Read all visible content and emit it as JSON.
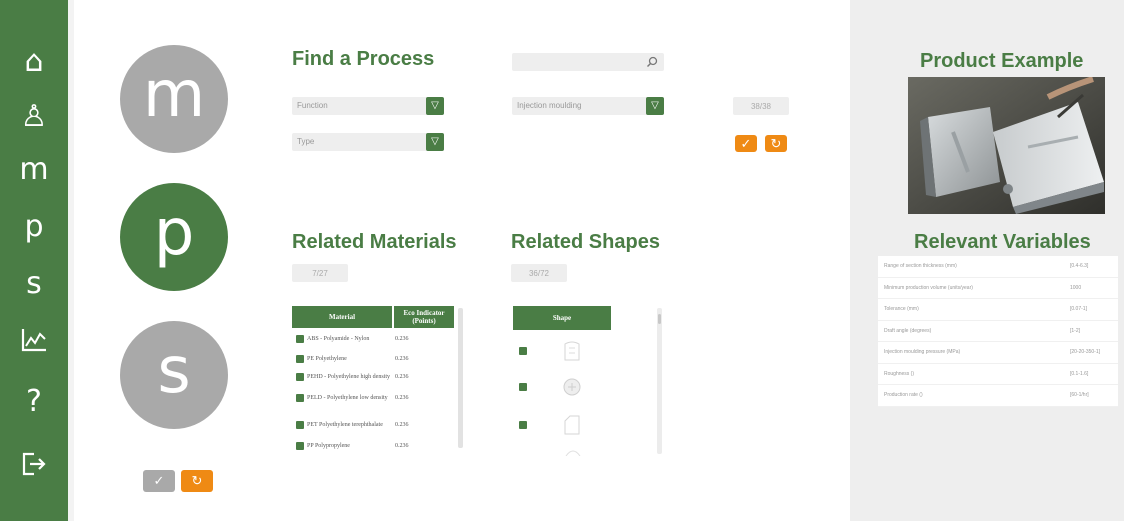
{
  "sidebar": {
    "items": [
      {
        "icon": "home-icon",
        "glyph": "⌂"
      },
      {
        "icon": "user-icon",
        "glyph": "♙"
      },
      {
        "icon": "m",
        "glyph": "m"
      },
      {
        "icon": "p",
        "glyph": "p"
      },
      {
        "icon": "s",
        "glyph": "s"
      },
      {
        "icon": "chart-icon",
        "glyph": "⟋"
      },
      {
        "icon": "help-icon",
        "glyph": "?"
      },
      {
        "icon": "logout-icon",
        "glyph": "⇥"
      }
    ]
  },
  "mode": {
    "materials_letter": "m",
    "processes_letter": "p",
    "shapes_letter": "s",
    "active": "p"
  },
  "find": {
    "title": "Find a Process",
    "select1": "Function",
    "select2": "Type",
    "select3": "Injection moulding",
    "search_placeholder": "",
    "count": "38/38"
  },
  "related_materials": {
    "title": "Related Materials",
    "count": "7/27",
    "col_material": "Material",
    "col_eco": "Eco Indicator (Points)",
    "rows": [
      {
        "name": "ABS - Polyamide - Nylon",
        "value": "0.236"
      },
      {
        "name": "PE Polyethylene",
        "value": "0.236"
      },
      {
        "name": "PEHD - Polyethylene high density",
        "value": "0.236"
      },
      {
        "name": "PELD - Polyethylene low density",
        "value": "0.236"
      },
      {
        "name": "PET Polyethylene terephthalate",
        "value": "0.236"
      },
      {
        "name": "PP Polypropylene",
        "value": "0.236"
      }
    ]
  },
  "related_shapes": {
    "title": "Related Shapes",
    "count": "36/72",
    "col_shape": "Shape"
  },
  "product": {
    "title": "Product Example"
  },
  "variables": {
    "title": "Relevant Variables",
    "rows": [
      {
        "name": "Range of section thickness (mm)",
        "value": "[0.4-6.3]"
      },
      {
        "name": "Minimum production volume (units/year)",
        "value": "1000"
      },
      {
        "name": "Tolerance (mm)",
        "value": "[0.07-1]"
      },
      {
        "name": "Draft angle (degrees)",
        "value": "[1-2]"
      },
      {
        "name": "Injection moulding pressure (MPa)",
        "value": "[20-20-350-1]"
      },
      {
        "name": "Roughness ()",
        "value": "[0.1-1.6]"
      },
      {
        "name": "Production rate ()",
        "value": "[60-1/hr]"
      }
    ]
  },
  "colors": {
    "accent": "#4a7d45",
    "orange": "#ef8a14",
    "inactive": "#a9a9a9"
  }
}
